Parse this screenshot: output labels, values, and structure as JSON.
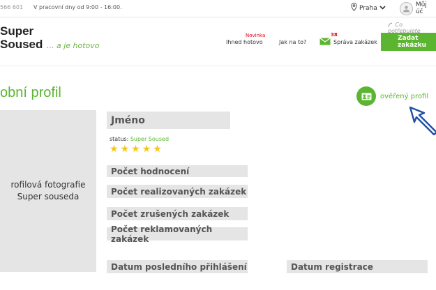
{
  "topbar": {
    "phone": "566 601",
    "hours": "V pracovní dny od 9:00 - 16:00.",
    "location": "Praha",
    "account": "Můj úč"
  },
  "header": {
    "logo_line1": "Super",
    "logo_line2": "Soused",
    "tagline": "... a je hotovo",
    "nav": {
      "novinka_badge": "Novinka",
      "ihned_hotovo": "Ihned hotovo",
      "jak_na_to": "Jak na to?",
      "sprava_count": "38",
      "sprava_zakazek": "Správa zakázek"
    },
    "cta_hint": "Co potřebujete",
    "cta_button": "Zadat zakázku"
  },
  "profile": {
    "title": "obní profil",
    "verified_label": "ověřený profil",
    "photo_label_line1": "rofilová fotografie",
    "photo_label_line2": "Super souseda",
    "name_label": "Jméno",
    "status_prefix": "status: ",
    "status_value": "Super Soused",
    "stars_count": 5,
    "fields": {
      "pocet_hodnoceni": "Počet hodnocení",
      "realizovanych": "Počet realizovaných zakázek",
      "zrusenych": "Počet zrušených zakázek",
      "reklamovanych": "Počet reklamovaných zakázek",
      "posledni_prihlaseni": "Datum posledního přihlášení",
      "registrace": "Datum registrace"
    }
  },
  "colors": {
    "accent": "#5bb531",
    "badge_red": "#e2001a",
    "field_bg": "#e5e5e5",
    "star": "#f5c518"
  }
}
